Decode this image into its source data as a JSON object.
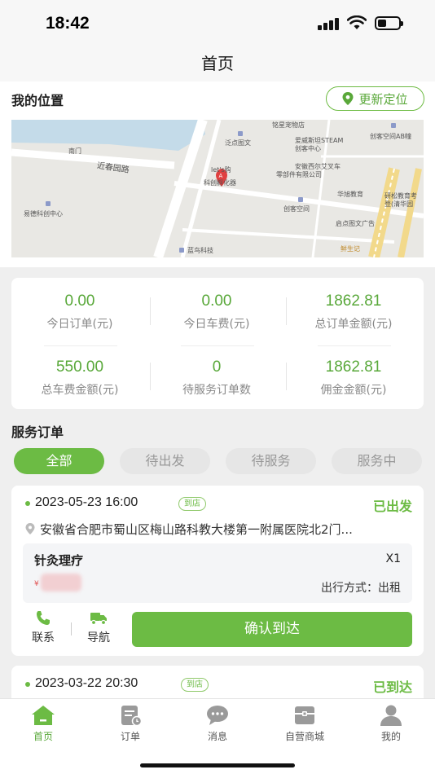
{
  "status_bar": {
    "time": "18:42"
  },
  "header": {
    "title": "首页"
  },
  "location": {
    "title": "我的位置",
    "relocate_label": "更新定位",
    "map_labels": [
      "南门",
      "近春园路",
      "泛点图文",
      "let's购",
      "铭星宠物店",
      "爱威斯坦STEAM",
      "创客中心",
      "安徽西尔艾叉车",
      "零部件有限公司",
      "创客空间AB幢",
      "易德科创中心",
      "科创孵化器",
      "创客空间",
      "华旭教育",
      "研松教育考",
      "登(清华园",
      "启点图文广告",
      "鲜生记",
      "蓝鸟科技"
    ]
  },
  "stats": [
    {
      "value": "0.00",
      "label": "今日订单(元)"
    },
    {
      "value": "0.00",
      "label": "今日车费(元)"
    },
    {
      "value": "1862.81",
      "label": "总订单金额(元)"
    },
    {
      "value": "550.00",
      "label": "总车费金额(元)"
    },
    {
      "value": "0",
      "label": "待服务订单数"
    },
    {
      "value": "1862.81",
      "label": "佣金金额(元)"
    }
  ],
  "orders_section": {
    "title": "服务订单",
    "tabs": [
      "全部",
      "待出发",
      "待服务",
      "服务中"
    ],
    "active_tab": "全部"
  },
  "orders": [
    {
      "datetime": "2023-05-23 16:00",
      "tag": "到店",
      "status": "已出发",
      "address": "安徽省合肥市蜀山区梅山路科教大楼第一附属医院北2门...",
      "service_name": "针灸理疗",
      "quantity": "X1",
      "price_symbol": "¥",
      "travel_mode": "出行方式：出租",
      "contact_label": "联系",
      "navigate_label": "导航",
      "confirm_label": "确认到达"
    },
    {
      "datetime": "2023-03-22 20:30",
      "tag": "到店",
      "status": "已到达"
    }
  ],
  "tab_bar": {
    "items": [
      {
        "label": "首页",
        "icon": "home-icon"
      },
      {
        "label": "订单",
        "icon": "order-icon"
      },
      {
        "label": "消息",
        "icon": "message-icon"
      },
      {
        "label": "自营商城",
        "icon": "shop-icon"
      },
      {
        "label": "我的",
        "icon": "profile-icon"
      }
    ],
    "active": "首页"
  },
  "colors": {
    "accent": "#6cbb44",
    "value_green": "#59a83a",
    "background": "#efefef"
  }
}
